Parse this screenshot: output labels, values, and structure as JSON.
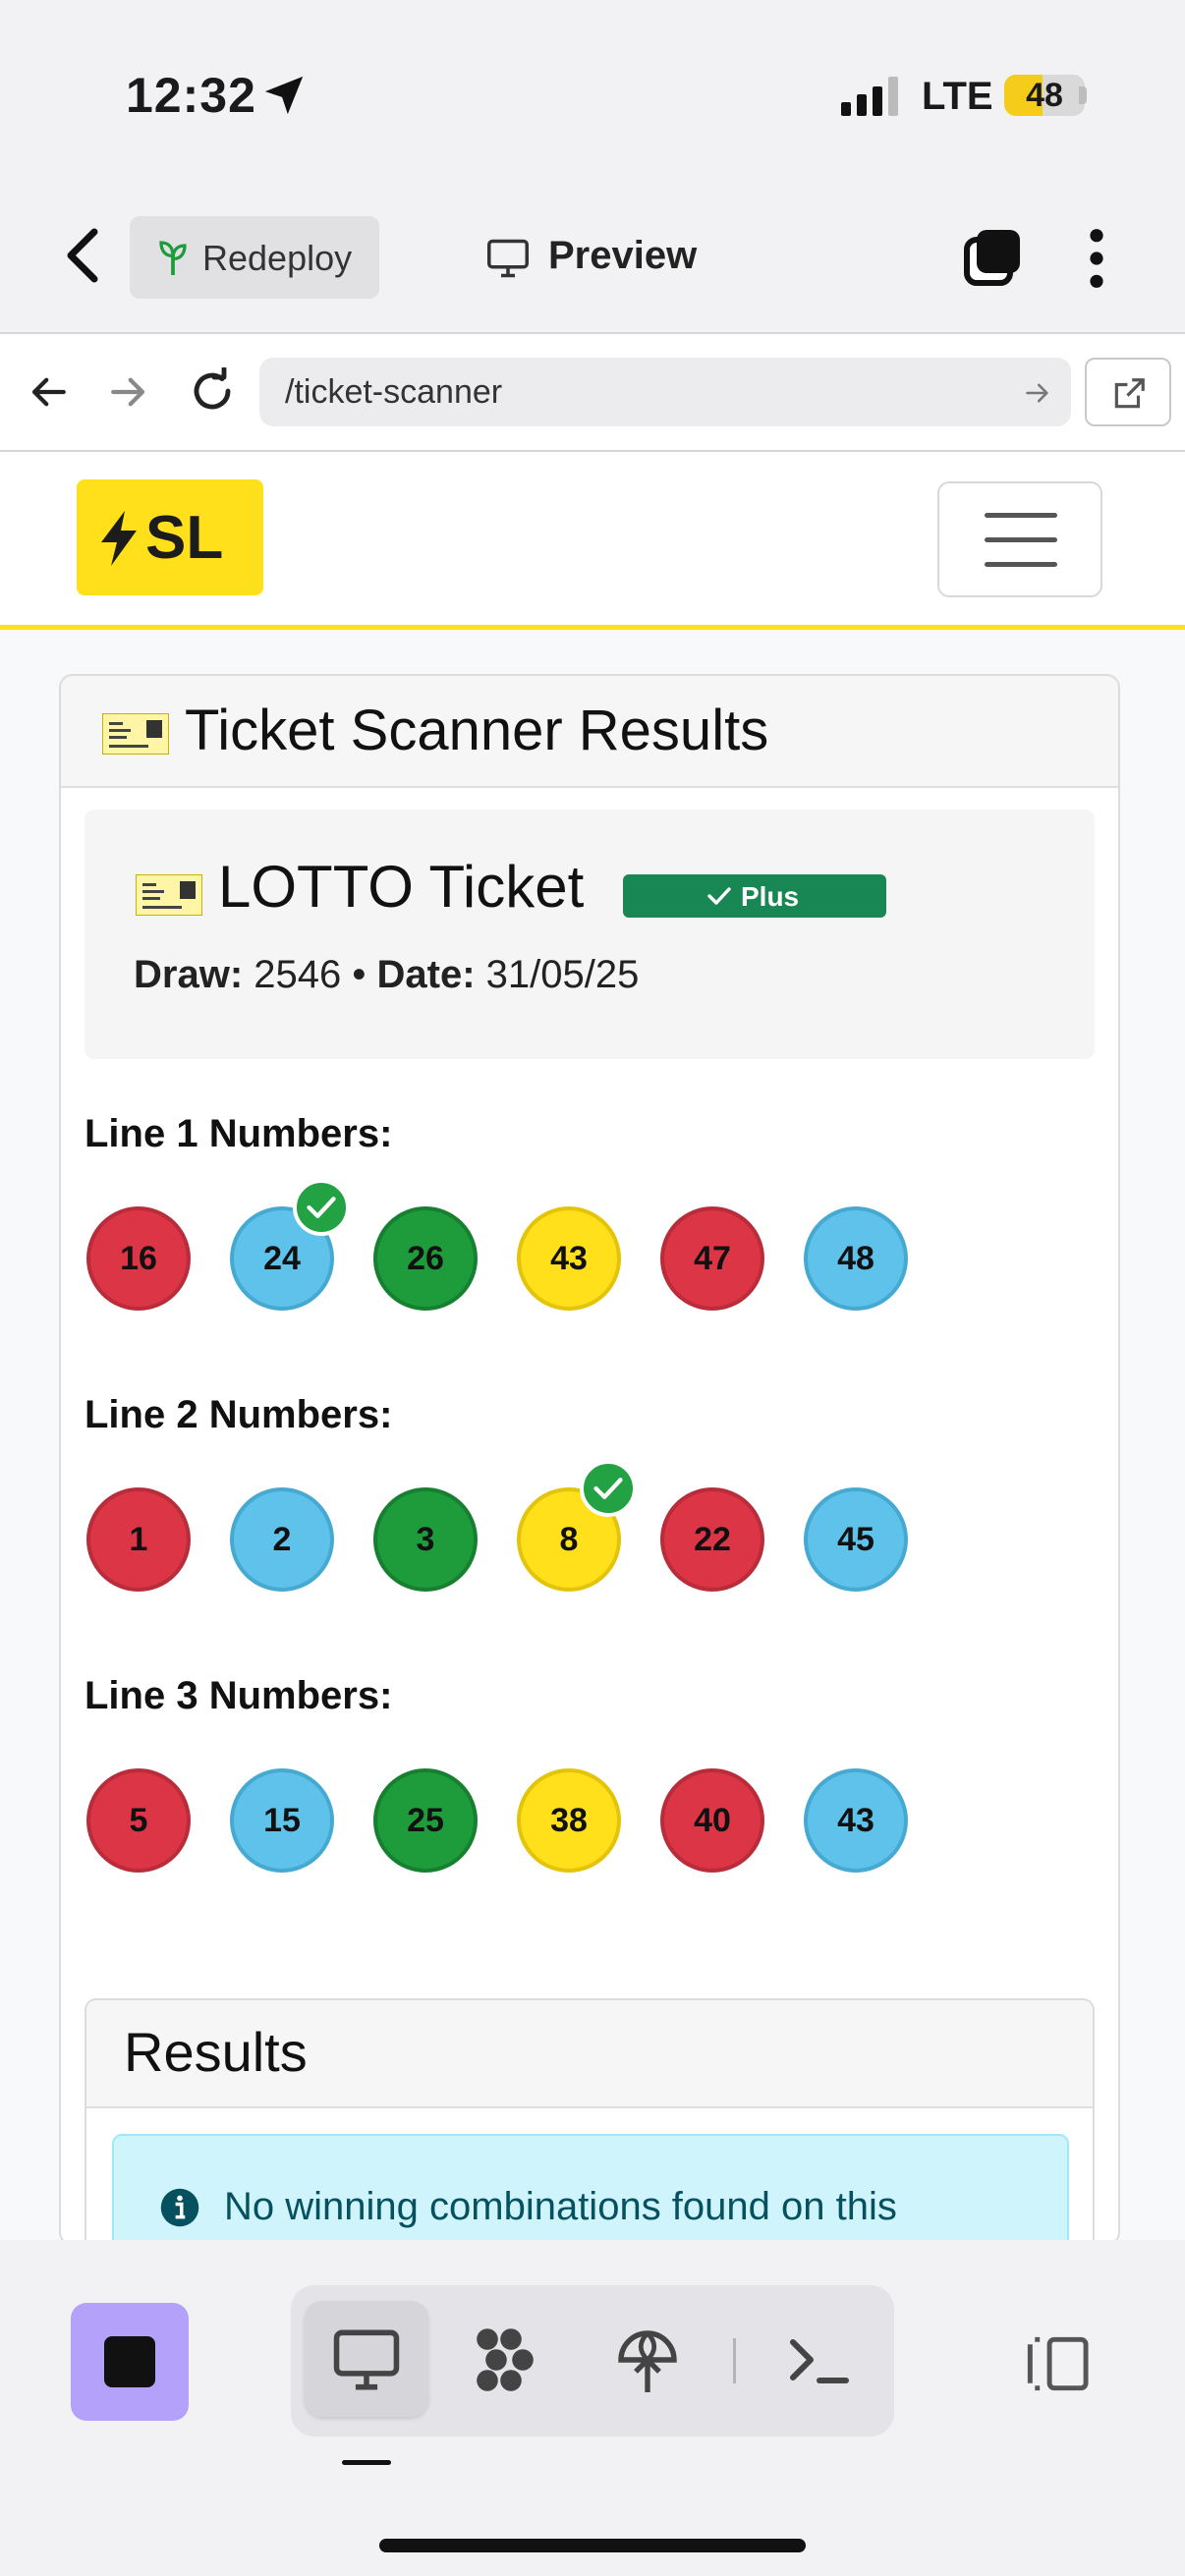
{
  "status_bar": {
    "time": "12:32",
    "network": "LTE",
    "battery": "48",
    "battery_level": 0.48
  },
  "toolbar": {
    "redeploy_label": "Redeploy",
    "preview_label": "Preview"
  },
  "browser": {
    "url": "/ticket-scanner"
  },
  "navbar": {
    "logo_text": "SL"
  },
  "card": {
    "title": "Ticket Scanner Results",
    "ticket": {
      "name": "LOTTO Ticket",
      "badge": "Plus",
      "draw_label": "Draw:",
      "draw": "2546",
      "separator": "•",
      "date_label": "Date:",
      "date": "31/05/25"
    },
    "lines": [
      {
        "label": "Line 1 Numbers:",
        "balls": [
          {
            "n": "16",
            "color": "red",
            "matched": false
          },
          {
            "n": "24",
            "color": "blue",
            "matched": true
          },
          {
            "n": "26",
            "color": "green",
            "matched": false
          },
          {
            "n": "43",
            "color": "yellow",
            "matched": false
          },
          {
            "n": "47",
            "color": "red",
            "matched": false
          },
          {
            "n": "48",
            "color": "blue",
            "matched": false
          }
        ]
      },
      {
        "label": "Line 2 Numbers:",
        "balls": [
          {
            "n": "1",
            "color": "red",
            "matched": false
          },
          {
            "n": "2",
            "color": "blue",
            "matched": false
          },
          {
            "n": "3",
            "color": "green",
            "matched": false
          },
          {
            "n": "8",
            "color": "yellow",
            "matched": true
          },
          {
            "n": "22",
            "color": "red",
            "matched": false
          },
          {
            "n": "45",
            "color": "blue",
            "matched": false
          }
        ]
      },
      {
        "label": "Line 3 Numbers:",
        "balls": [
          {
            "n": "5",
            "color": "red",
            "matched": false
          },
          {
            "n": "15",
            "color": "blue",
            "matched": false
          },
          {
            "n": "25",
            "color": "green",
            "matched": false
          },
          {
            "n": "38",
            "color": "yellow",
            "matched": false
          },
          {
            "n": "40",
            "color": "red",
            "matched": false
          },
          {
            "n": "43",
            "color": "blue",
            "matched": false
          }
        ]
      }
    ],
    "results": {
      "title": "Results",
      "alert": "No winning combinations found on this"
    }
  },
  "colors": {
    "brand_yellow": "#ffe01b",
    "success": "#198754",
    "info_bg": "#cff4fc",
    "stop_button": "#b4a1fa"
  },
  "icons": {
    "status": [
      "location-arrow-icon",
      "signal-icon"
    ],
    "toolbar": [
      "back-chevron-icon",
      "sprout-icon",
      "monitor-icon",
      "tabs-icon",
      "kebab-menu-icon"
    ],
    "browser": [
      "back-arrow-icon",
      "forward-arrow-icon",
      "reload-icon",
      "go-arrow-icon",
      "external-link-icon"
    ],
    "bottom": [
      "stop-icon",
      "monitor-icon",
      "workflow-icon",
      "deploy-icon",
      "terminal-icon",
      "side-panel-icon"
    ]
  }
}
